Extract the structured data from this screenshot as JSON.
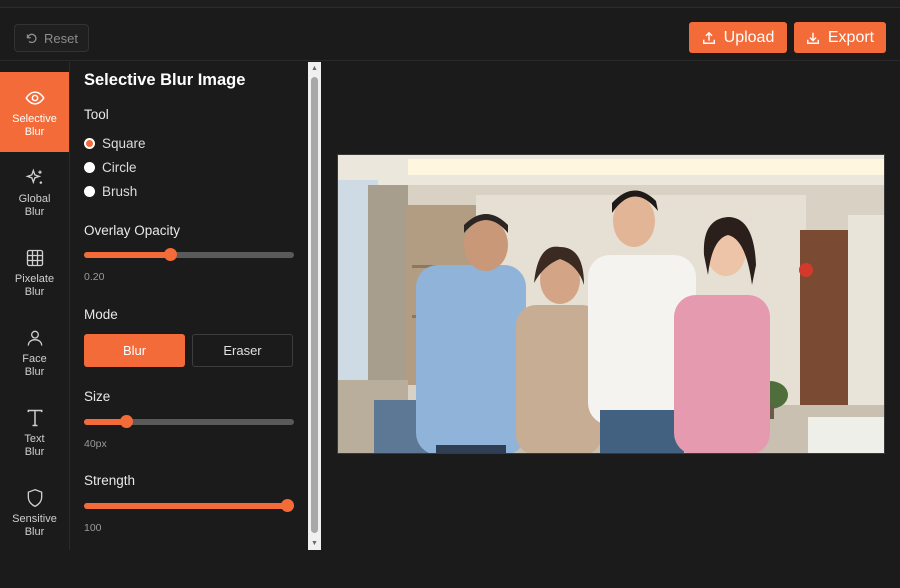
{
  "header": {
    "reset_label": "Reset",
    "upload_label": "Upload",
    "export_label": "Export"
  },
  "nav": [
    {
      "label": "Selective\nBlur",
      "icon": "eye-icon",
      "active": true
    },
    {
      "label": "Global\nBlur",
      "icon": "sparkle-icon",
      "active": false
    },
    {
      "label": "Pixelate\nBlur",
      "icon": "grid-icon",
      "active": false
    },
    {
      "label": "Face\nBlur",
      "icon": "person-icon",
      "active": false
    },
    {
      "label": "Text\nBlur",
      "icon": "text-icon",
      "active": false
    },
    {
      "label": "Sensitive\nBlur",
      "icon": "shield-icon",
      "active": false
    }
  ],
  "panel": {
    "title": "Selective Blur Image",
    "tool_label": "Tool",
    "tools": [
      "Square",
      "Circle",
      "Brush"
    ],
    "selected_tool": "Square",
    "opacity_label": "Overlay Opacity",
    "opacity_value": "0.20",
    "opacity_fraction": 0.41,
    "mode_label": "Mode",
    "mode_blur": "Blur",
    "mode_eraser": "Eraser",
    "size_label": "Size",
    "size_value": "40px",
    "size_fraction": 0.2,
    "strength_label": "Strength",
    "strength_value": "100",
    "strength_fraction": 1.0
  },
  "colors": {
    "accent": "#f26b38",
    "background": "#1b1b1b"
  },
  "image": {
    "icon": "family-photo"
  }
}
